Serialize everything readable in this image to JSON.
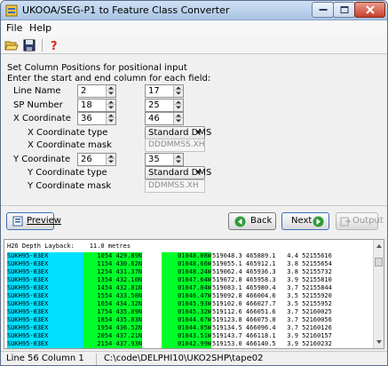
{
  "window": {
    "title": "UKOOA/SEG-P1 to Feature Class Converter"
  },
  "menu": {
    "file": "File",
    "help": "Help"
  },
  "toolbar": {
    "open_icon": "folder-open-icon",
    "save_icon": "floppy-disk-icon",
    "help_icon": "question-mark-icon"
  },
  "form": {
    "heading": "Set Column Positions for positional input",
    "instruction": "Enter the start and end column for each field:",
    "line_name": {
      "label": "Line Name",
      "start": "2",
      "end": "17"
    },
    "sp_number": {
      "label": "SP Number",
      "start": "18",
      "end": "25"
    },
    "x_coord": {
      "label": "X Coordinate",
      "start": "36",
      "end": "46",
      "type_label": "X Coordinate type",
      "type_value": "Standard DMS",
      "mask_label": "X Coordinate mask",
      "mask_value": "DDDMMSS.XH"
    },
    "y_coord": {
      "label": "Y Coordinate",
      "start": "26",
      "end": "35",
      "type_label": "Y Coordinate type",
      "type_value": "Standard DMS",
      "mask_label": "Y Coordinate mask",
      "mask_value": "DDMMSS.XH"
    }
  },
  "buttons": {
    "preview": "Preview",
    "back": "Back",
    "next": "Next",
    "output": "Output"
  },
  "output": {
    "header": "H26 Depth Layback:    11.0 metres",
    "rows": [
      {
        "line": "SUKH95-03EX",
        "sp": "1054 429.89N",
        "x": "01048.08W",
        "rest": "519048.3 465889.1   4.4 52155616"
      },
      {
        "line": "SUKH95-03EX",
        "sp": "1154 430.62N",
        "x": "01048.66W",
        "rest": "519055.1 465912.1   3.8 52155654"
      },
      {
        "line": "SUKH95-03EX",
        "sp": "1254 431.37N",
        "x": "01048.24W",
        "rest": "519062.4 465936.3   3.8 52155732"
      },
      {
        "line": "SUKH95-03EX",
        "sp": "1354 432.10N",
        "x": "01047.64W",
        "rest": "519072.8 465958.3   3.9 52155810"
      },
      {
        "line": "SUKH95-03EX",
        "sp": "1454 432.81N",
        "x": "01047.04W",
        "rest": "519083.1 465980.4   3.7 52155844"
      },
      {
        "line": "SUKH95-03EX",
        "sp": "1554 433.58N",
        "x": "01046.47W",
        "rest": "519092.8 466004.6   3.5 52155920"
      },
      {
        "line": "SUKH95-03EX",
        "sp": "1654 434.32N",
        "x": "01045.93W",
        "rest": "519102.0 466027.7   3.5 52155952"
      },
      {
        "line": "SUKH95-03EX",
        "sp": "1754 435.09N",
        "x": "01045.32W",
        "rest": "519112.6 466051.6   3.7 52160025"
      },
      {
        "line": "SUKH95-03EX",
        "sp": "1854 435.83N",
        "x": "01044.67W",
        "rest": "519123.8 466075.0   3.7 52160056"
      },
      {
        "line": "SUKH95-03EX",
        "sp": "1954 436.52N",
        "x": "01044.05W",
        "rest": "519134.5 466096.4   3.7 52160126"
      },
      {
        "line": "SUKH95-03EX",
        "sp": "2054 437.21N",
        "x": "01043.51W",
        "rest": "519143.7 466118.1   3.9 52160157"
      },
      {
        "line": "SUKH95-03EX",
        "sp": "2154 437.93N",
        "x": "01042.99W",
        "rest": "519153.0 466140.5   3.9 52160232"
      },
      {
        "line": "SUKH95-03EX",
        "sp": "2254 438.68N",
        "x": "01042.46W",
        "rest": "519162.6 466164.0   4.1 52160315"
      }
    ]
  },
  "status": {
    "position": "Line 56 Column 1",
    "path": "C:\\code\\DELPHI10\\UKO2SHP\\tape02"
  }
}
